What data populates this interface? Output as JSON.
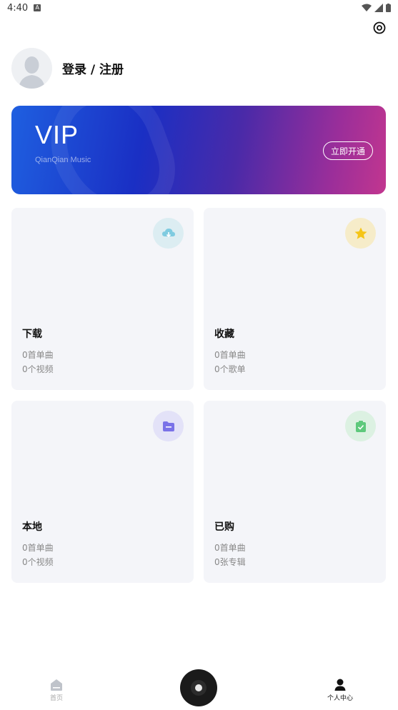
{
  "status_bar": {
    "time": "4:40",
    "notification": "A"
  },
  "profile": {
    "login_text": "登录 / 注册"
  },
  "vip": {
    "title": "VIP",
    "subtitle": "QianQian Music",
    "open_button": "立即开通"
  },
  "cards": [
    {
      "title": "下载",
      "line1": "0首单曲",
      "line2": "0个视频",
      "icon": "cloud-download-icon",
      "icon_bg": "#dcedf2",
      "icon_color": "#7fcbe0"
    },
    {
      "title": "收藏",
      "line1": "0首单曲",
      "line2": "0个歌单",
      "icon": "star-icon",
      "icon_bg": "#f6ecc9",
      "icon_color": "#f5c518"
    },
    {
      "title": "本地",
      "line1": "0首单曲",
      "line2": "0个视频",
      "icon": "folder-icon",
      "icon_bg": "#e3e2f8",
      "icon_color": "#7a72e8"
    },
    {
      "title": "已购",
      "line1": "0首单曲",
      "line2": "0张专辑",
      "icon": "purchased-bag-icon",
      "icon_bg": "#dcf1e2",
      "icon_color": "#5ec97c"
    }
  ],
  "bottom_nav": {
    "home_label": "首页",
    "me_label": "个人中心"
  },
  "colors": {
    "banner_start": "#1f5fe0",
    "banner_end": "#c2368f",
    "card_bg": "#f4f5f9"
  }
}
